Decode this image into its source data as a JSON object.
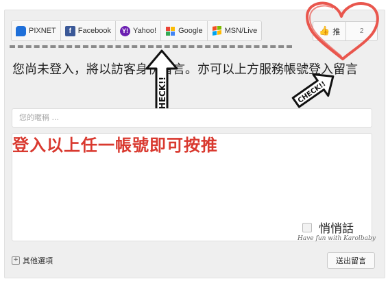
{
  "login_bar": {
    "buttons": [
      {
        "label": "PIXNET",
        "icon": "pixnet-icon",
        "color": "#1e6fd9"
      },
      {
        "label": "Facebook",
        "icon": "facebook-icon",
        "color": "#3b5998"
      },
      {
        "label": "Yahoo!",
        "icon": "yahoo-icon",
        "color": "#6b1fb1"
      },
      {
        "label": "Google",
        "icon": "google-icon",
        "color": "#4285f4"
      },
      {
        "label": "MSN/Live",
        "icon": "msn-icon",
        "color": "#f25022"
      }
    ]
  },
  "push": {
    "label": "推",
    "count": "2"
  },
  "annotations": {
    "check_left": "CHECK!!",
    "check_right": "CHECK!!",
    "overlay_text": "登入以上任一帳號即可按推",
    "heart_color": "#e9564d"
  },
  "form": {
    "notice": "您尚未登入，將以訪客身份留言。亦可以上方服務帳號登入留言",
    "nickname_placeholder": "您的暱稱 ...",
    "whisper_label": "悄悄話",
    "credit": "Have fun with Karolbaby",
    "more_options": "其他選項",
    "submit_label": "送出留言"
  }
}
